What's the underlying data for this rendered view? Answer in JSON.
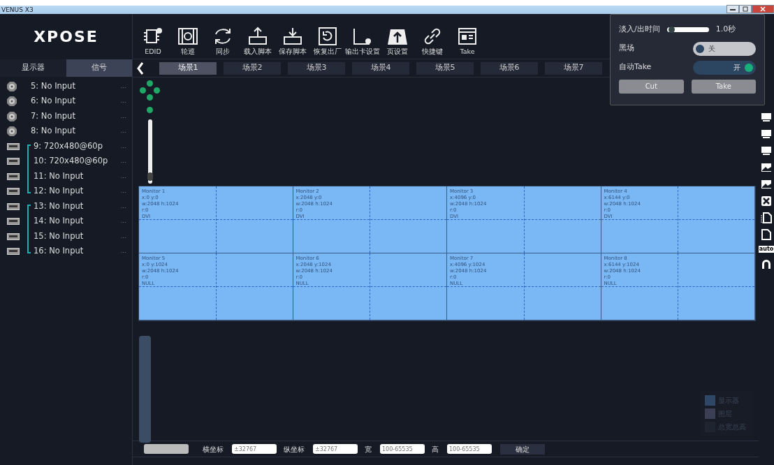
{
  "window": {
    "title": "VENUS X3"
  },
  "logo": {
    "text": "XPOSE"
  },
  "side_tabs": [
    {
      "label": "显示器",
      "selected": false
    },
    {
      "label": "信号",
      "selected": true
    }
  ],
  "signals": [
    {
      "kind": "bnc",
      "label": "5: No Input",
      "more": "..."
    },
    {
      "kind": "bnc",
      "label": "6: No Input",
      "more": "..."
    },
    {
      "kind": "bnc",
      "label": "7: No Input",
      "more": "..."
    },
    {
      "kind": "bnc",
      "label": "8: No Input",
      "more": "..."
    },
    {
      "kind": "group",
      "children": [
        {
          "kind": "card",
          "label": "9: 720x480@60p",
          "more": "..."
        },
        {
          "kind": "card",
          "label": "10: 720x480@60p",
          "more": "..."
        },
        {
          "kind": "card",
          "label": "11: No Input",
          "more": "..."
        },
        {
          "kind": "card",
          "label": "12: No Input",
          "more": "..."
        }
      ]
    },
    {
      "kind": "group",
      "children": [
        {
          "kind": "card",
          "label": "13: No Input",
          "more": "..."
        },
        {
          "kind": "card",
          "label": "14: No Input",
          "more": "..."
        },
        {
          "kind": "card",
          "label": "15: No Input",
          "more": "..."
        },
        {
          "kind": "card",
          "label": "16: No Input",
          "more": "..."
        }
      ]
    }
  ],
  "toolbar": [
    {
      "kind": "chip",
      "label": "EDID"
    },
    {
      "kind": "film",
      "label": "轮巡"
    },
    {
      "kind": "sync",
      "label": "同步"
    },
    {
      "kind": "upload",
      "label": "载入脚本"
    },
    {
      "kind": "download",
      "label": "保存脚本"
    },
    {
      "kind": "restore",
      "label": "恢复出厂"
    },
    {
      "kind": "card",
      "label": "输出卡设置"
    },
    {
      "kind": "cloud",
      "label": "页设置"
    },
    {
      "kind": "link",
      "label": "快捷键"
    },
    {
      "kind": "news",
      "label": "Take"
    }
  ],
  "scenes": [
    {
      "label": "场景1",
      "selected": true
    },
    {
      "label": "场景2",
      "selected": false
    },
    {
      "label": "场景3",
      "selected": false
    },
    {
      "label": "场景4",
      "selected": false
    },
    {
      "label": "场景5",
      "selected": false
    },
    {
      "label": "场景6",
      "selected": false
    },
    {
      "label": "场景7",
      "selected": false
    }
  ],
  "zoom_slider": {
    "level": 0.05
  },
  "monitors": [
    {
      "name": "Monitor 1",
      "pos": "x:0  y:0",
      "size": "w:2048  h:1024",
      "r": "r:0",
      "signal": "DVI"
    },
    {
      "name": "Monitor 2",
      "pos": "x:2048  y:0",
      "size": "w:2048  h:1024",
      "r": "r:0",
      "signal": "DVI"
    },
    {
      "name": "Monitor 3",
      "pos": "x:4096  y:0",
      "size": "w:2048  h:1024",
      "r": "r:0",
      "signal": "DVI"
    },
    {
      "name": "Monitor 4",
      "pos": "x:6144  y:0",
      "size": "w:2048  h:1024",
      "r": "r:0",
      "signal": "DVI"
    },
    {
      "name": "Monitor 5",
      "pos": "x:0  y:1024",
      "size": "w:2048  h:1024",
      "r": "r:0",
      "signal": "NULL"
    },
    {
      "name": "Monitor 6",
      "pos": "x:2048  y:1024",
      "size": "w:2048  h:1024",
      "r": "r:0",
      "signal": "NULL"
    },
    {
      "name": "Monitor 7",
      "pos": "x:4096  y:1024",
      "size": "w:2048  h:1024",
      "r": "r:0",
      "signal": "NULL"
    },
    {
      "name": "Monitor 8",
      "pos": "x:6144  y:1024",
      "size": "w:2048  h:1024",
      "r": "r:0",
      "signal": "NULL"
    }
  ],
  "legend": [
    {
      "label": "显示器",
      "color": "#2e4766"
    },
    {
      "label": "图层",
      "color": "#3b3f55"
    },
    {
      "label": "总宽总高",
      "color": "#1e2430"
    }
  ],
  "bottom_bar": {
    "fields": [
      {
        "label": "横坐标",
        "placeholder": "±32767"
      },
      {
        "label": "纵坐标",
        "placeholder": "±32767"
      },
      {
        "label": "宽",
        "placeholder": "100-65535"
      },
      {
        "label": "高",
        "placeholder": "100-65535"
      }
    ],
    "confirm": "确定"
  },
  "right_tools": [
    {
      "kind": "monitor"
    },
    {
      "kind": "monitor"
    },
    {
      "kind": "monitor"
    },
    {
      "kind": "image"
    },
    {
      "kind": "image"
    },
    {
      "kind": "close"
    },
    {
      "kind": "pages"
    },
    {
      "kind": "page"
    },
    {
      "kind": "text",
      "label": "auto"
    },
    {
      "kind": "arch"
    }
  ],
  "take_panel": {
    "fade_label": "淡入/出时间",
    "fade": {
      "level": 0.05
    },
    "fade_reading": "1.0秒",
    "toggles": [
      {
        "label": "黑场",
        "on": false,
        "state_text": "关"
      },
      {
        "label": "自动Take",
        "on": true,
        "state_text": "开"
      }
    ],
    "buttons": [
      "Cut",
      "Take"
    ]
  }
}
